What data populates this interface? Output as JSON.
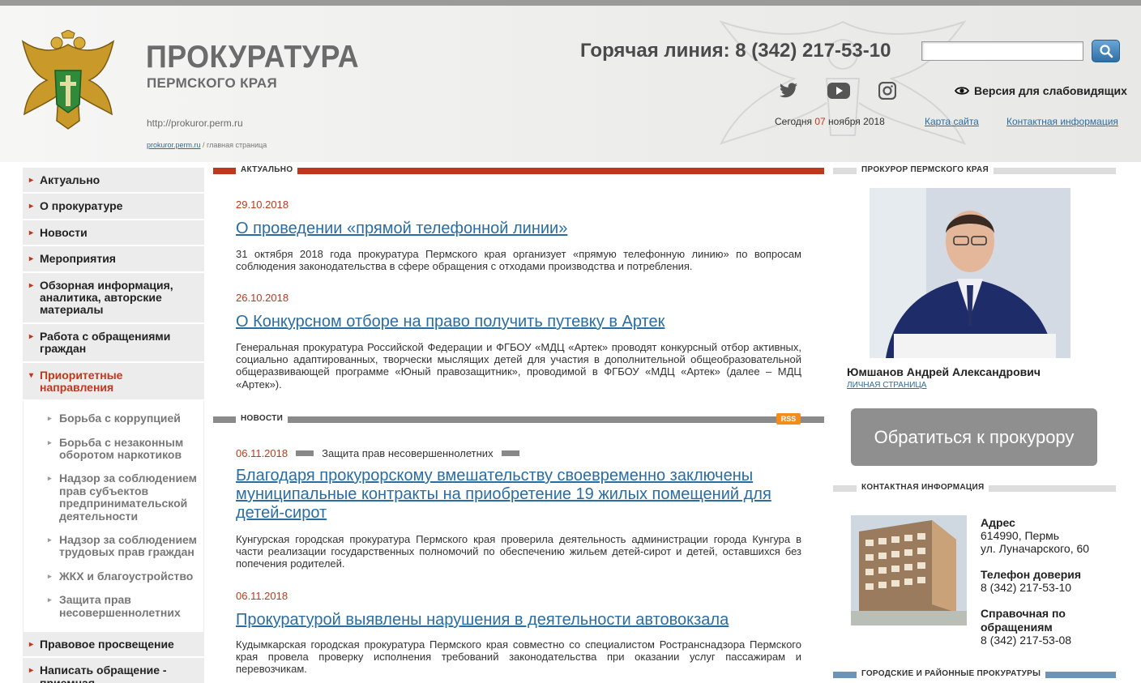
{
  "header": {
    "title": "ПРОКУРАТУРА",
    "subtitle": "ПЕРМСКОГО КРАЯ",
    "url": "http://prokuror.perm.ru",
    "breadcrumb_link": "prokuror.perm.ru",
    "breadcrumb_rest": " / главная страница",
    "hotline": "Горячая линия: 8 (342) 217-53-10",
    "search_placeholder": "",
    "accessibility": "Версия для слабовидящих",
    "date_prefix": "Сегодня",
    "date_day": "07",
    "date_rest": "ноября 2018",
    "sitemap": "Карта сайта",
    "contact_info": "Контактная информация"
  },
  "nav": {
    "items_top": [
      "Актуально",
      "О прокуратуре",
      "Новости",
      "Мероприятия",
      "Обзорная информация, аналитика, авторские материалы",
      "Работа с обращениями граждан"
    ],
    "active": "Приоритетные направления",
    "sub_items": [
      "Борьба с коррупцией",
      "Борьба с незаконным оборотом наркотиков",
      "Надзор за соблюдением прав субъектов предпринимательской деятельности",
      "Надзор за соблюдением трудовых прав граждан",
      "ЖКХ и благоустройство",
      "Защита прав несовершеннолетних"
    ],
    "items_bottom": [
      "Правовое просвещение",
      "Написать обращение - приемная"
    ]
  },
  "actual": {
    "label": "АКТУАЛЬНО",
    "items": [
      {
        "date": "29.10.2018",
        "title": "О проведении «прямой телефонной линии»",
        "text": "31 октября 2018 года прокуратура Пермского края организует «прямую телефонную линию» по вопросам соблюдения законодательства в сфере обращения с отходами производства и потребления."
      },
      {
        "date": "26.10.2018",
        "title": "О Конкурсном отборе на право получить путевку в Артек",
        "text": "Генеральная прокуратура Российской Федерации и ФГБОУ «МДЦ «Артек» проводят конкурсный отбор активных, социально адаптированных, творчески мыслящих детей для участия в дополнительной общеобразовательной общеразвивающей программе «Юный правозащитник», проводимой в ФГБОУ «МДЦ «Артек» (далее – МДЦ «Артек»)."
      }
    ]
  },
  "news": {
    "label": "НОВОСТИ",
    "rss": "RSS",
    "items": [
      {
        "date": "06.11.2018",
        "tag": "Защита прав несовершеннолетних",
        "title": "Благодаря прокурорскому вмешательству своевременно заключены муниципальные контракты на приобретение 19 жилых помещений для детей-сирот",
        "text": "Кунгурская городская прокуратура Пермского края проверила деятельность администрации города Кунгура в части реализации государственных полномочий по обеспечению жильем детей-сирот и детей, оставшихся без попечения родителей."
      },
      {
        "date": "06.11.2018",
        "title": "Прокуратурой выявлены нарушения в деятельности автовокзала",
        "text": "Кудымкарская городская прокуратура Пермского края совместно со специалистом Ространснадзора Пермского края провела проверку исполнения требований законодательства при оказании услуг пассажирам и перевозчикам."
      }
    ]
  },
  "right": {
    "prosecutor_label": "ПРОКУРОР ПЕРМСКОГО КРАЯ",
    "name": "Юмшанов Андрей Александрович",
    "personal_page": "ЛИЧНАЯ СТРАНИЦА",
    "appeal_button": "Обратиться к прокурору",
    "contact_label": "КОНТАКТНАЯ ИНФОРМАЦИЯ",
    "address_h": "Адрес",
    "address_1": "614990, Пермь",
    "address_2": "ул. Луначарского, 60",
    "trust_h": "Телефон доверия",
    "trust_phone": "8 (342) 217-53-10",
    "ref_h": "Справочная по обращениям",
    "ref_phone": "8 (342) 217-53-08",
    "city_label": "ГОРОДСКИЕ И РАЙОННЫЕ ПРОКУРАТУРЫ"
  },
  "colors": {
    "accent_red": "#c0381b",
    "link_blue": "#2a6da3",
    "nav_bg": "#ececec",
    "appeal_bg": "#8f8f8f"
  }
}
